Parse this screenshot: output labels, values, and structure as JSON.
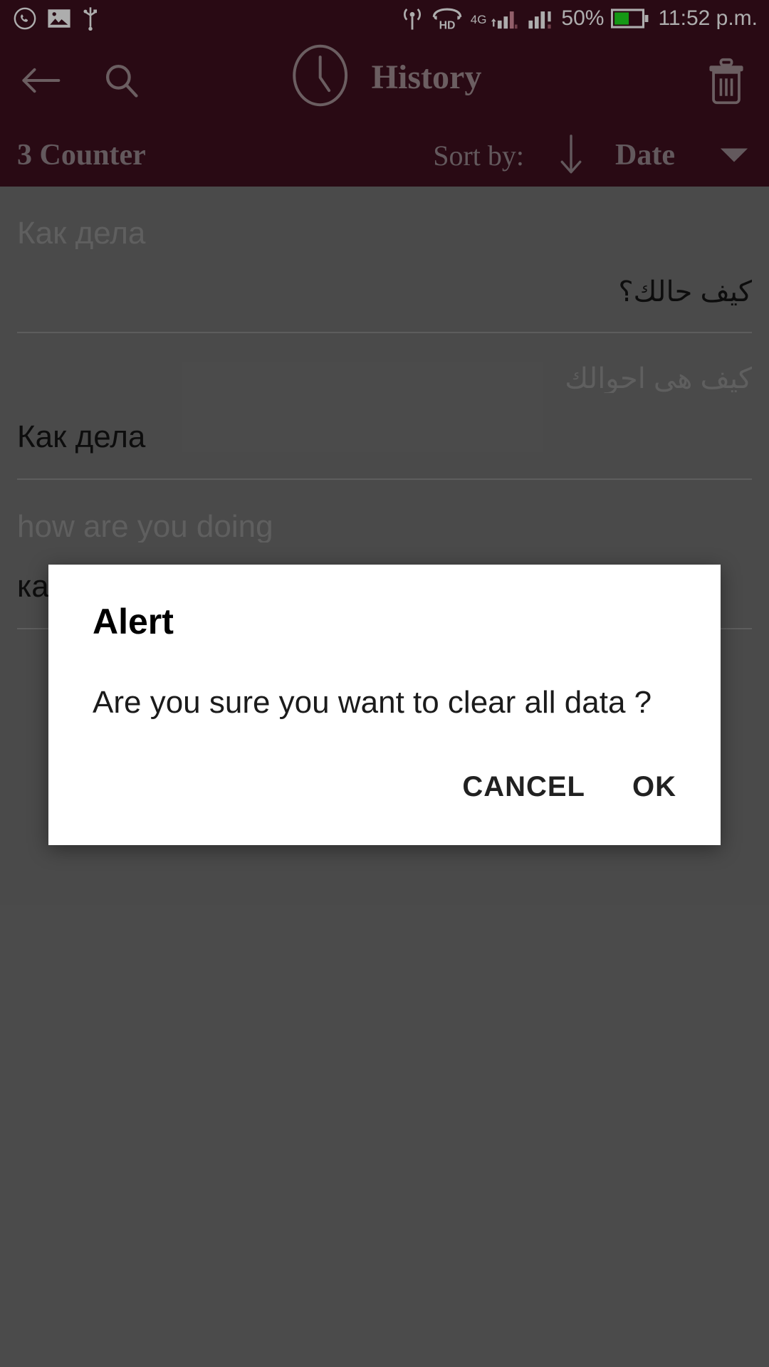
{
  "status_bar": {
    "left_icons": [
      "whatsapp-icon",
      "image-icon",
      "usb-icon"
    ],
    "right_icons": [
      "cast-icon",
      "hd-voice-icon",
      "signal-icon-1",
      "signal-icon-2",
      "battery-icon"
    ],
    "network_label": "4G",
    "hd_label": "HD",
    "battery_percent": "50%",
    "clock": "11:52 p.m.",
    "background_color": "#3d0f1e",
    "battery_fill_color": "#20e020"
  },
  "toolbar": {
    "title": "History",
    "back_label": "Back",
    "search_label": "Search",
    "delete_label": "Delete all",
    "icon_color": "#9e8b90",
    "background_color": "#3d0f1e"
  },
  "sort_bar": {
    "counter_label": "3 Counter",
    "sort_by_label": "Sort by:",
    "sort_direction": "descending",
    "sort_field": "Date",
    "text_color": "#93848a"
  },
  "history": {
    "items": [
      {
        "source_text": "Как дела",
        "source_dir": "ltr",
        "target_text": "كيف حالك؟",
        "target_dir": "rtl"
      },
      {
        "source_text": "كيف هي احوالك",
        "source_dir": "rtl",
        "target_text": "Как дела",
        "target_dir": "ltr"
      },
      {
        "source_text": "how are you doing",
        "source_dir": "ltr",
        "target_text": "как вы делаете",
        "target_dir": "ltr"
      }
    ],
    "background_color": "#6e6e6e",
    "source_text_color": "#8d8d8d",
    "target_text_color": "#141414"
  },
  "alert_dialog": {
    "title": "Alert",
    "message": "Are you sure you want to clear all data ?",
    "cancel_label": "CANCEL",
    "ok_label": "OK",
    "background_color": "#ffffff"
  }
}
